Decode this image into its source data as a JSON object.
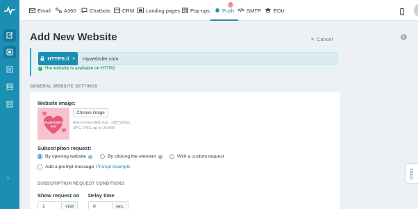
{
  "nav": {
    "items": [
      {
        "label": "Email",
        "icon": "mail-icon"
      },
      {
        "label": "A360",
        "icon": "automation-icon"
      },
      {
        "label": "Chatbots",
        "icon": "chat-bubble-icon"
      },
      {
        "label": "CRM",
        "icon": "crm-icon"
      },
      {
        "label": "Landing pages",
        "icon": "landing-page-icon"
      },
      {
        "label": "Pop-ups",
        "icon": "popup-icon"
      },
      {
        "label": "Push",
        "icon": "bell-icon"
      },
      {
        "label": "SMTP",
        "icon": "code-icon"
      },
      {
        "label": "EDU",
        "icon": "graduation-cap-icon"
      }
    ],
    "popups_badge": "8",
    "active": "Push"
  },
  "page": {
    "title": "Add New Website",
    "cancel_label": "Cancel"
  },
  "url": {
    "protocol": "HTTPS://",
    "value": "mywebsite.com",
    "status": "The website is available on HTTPS"
  },
  "general": {
    "heading": "GENERAL WEBSITE SETTINGS",
    "image_label": "Website image:",
    "choose_button": "Choose image",
    "hint_line1": "Recommended size: 128*128px",
    "hint_line2": "JPG, PNG up to 200KB",
    "thumb_text1": "VALENTINE'S",
    "thumb_text2": "DAY",
    "subscription_label": "Subscription request:",
    "options": [
      "By opening website",
      "By clicking the element",
      "With a custom request"
    ],
    "selected_option": "By opening website",
    "prompt_label": "Add a prompt message",
    "prompt_link": "Prompt example"
  },
  "conditions": {
    "heading": "SUBSCRIPTION REQUEST CONDITIONS",
    "show_label": "Show request on",
    "show_value": "1",
    "show_unit": "visit",
    "delay_label": "Delay time",
    "delay_value": "0",
    "delay_unit": "sec."
  },
  "chats_tab": "Chats",
  "colors": {
    "brand": "#1a8fb3",
    "success": "#3aa05a",
    "background": "#eef1f3"
  }
}
